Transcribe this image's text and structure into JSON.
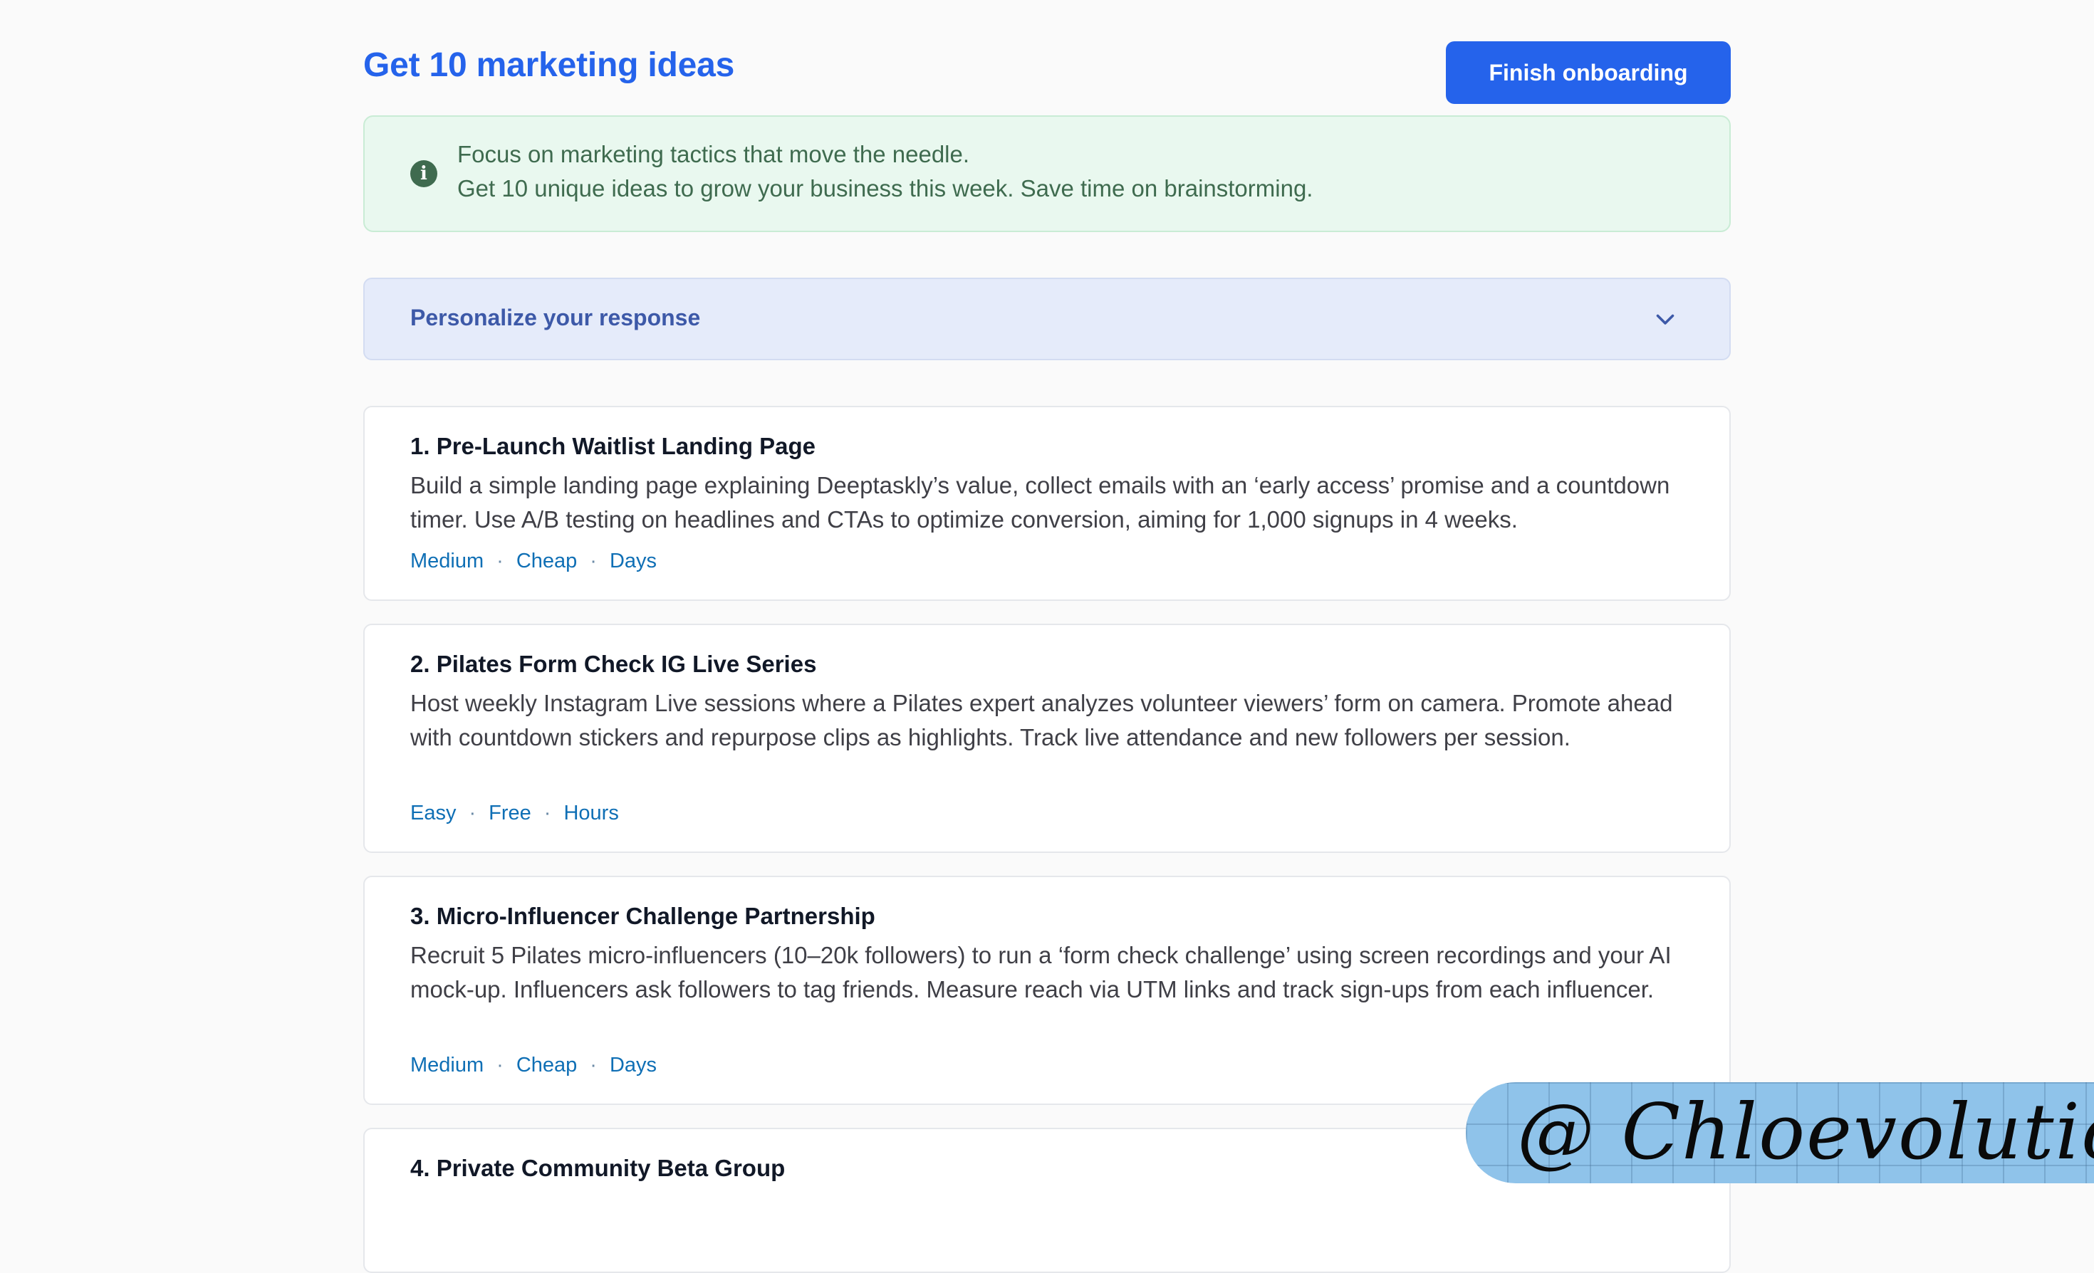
{
  "header": {
    "title": "Get 10 marketing ideas",
    "finish_button": "Finish onboarding"
  },
  "info": {
    "icon": "info-icon",
    "line1": "Focus on marketing tactics that move the needle.",
    "line2": "Get 10 unique ideas to grow your business this week. Save time on brainstorming."
  },
  "personalize": {
    "label": "Personalize your response",
    "icon": "chevron-down-icon"
  },
  "ideas": [
    {
      "title": "1. Pre-Launch Waitlist Landing Page",
      "description": "Build a simple landing page explaining Deeptaskly’s value, collect emails with an ‘early access’ promise and a countdown timer. Use A/B testing on headlines and CTAs to optimize conversion, aiming for 1,000 signups in 4 weeks.",
      "tags": [
        "Medium",
        "Cheap",
        "Days"
      ]
    },
    {
      "title": "2. Pilates Form Check IG Live Series",
      "description": "Host weekly Instagram Live sessions where a Pilates expert analyzes volunteer viewers’ form on camera. Promote ahead with countdown stickers and repurpose clips as highlights. Track live attendance and new followers per session.",
      "tags": [
        "Easy",
        "Free",
        "Hours"
      ]
    },
    {
      "title": "3. Micro-Influencer Challenge Partnership",
      "description": "Recruit 5 Pilates micro-influencers (10–20k followers) to run a ‘form check challenge’ using screen recordings and your AI mock-up. Influencers ask followers to tag friends. Measure reach via UTM links and track sign-ups from each influencer.",
      "tags": [
        "Medium",
        "Cheap",
        "Days"
      ]
    },
    {
      "title": "4. Private Community Beta Group"
    }
  ],
  "tag_separator": "·",
  "watermark": "@ Chloevolution",
  "colors": {
    "accent": "#2563eb",
    "info_bg": "#e9f8ef",
    "info_text": "#3f6b4f",
    "personalize_bg": "#e5ebfa",
    "tag_text": "#0f6fb5"
  }
}
